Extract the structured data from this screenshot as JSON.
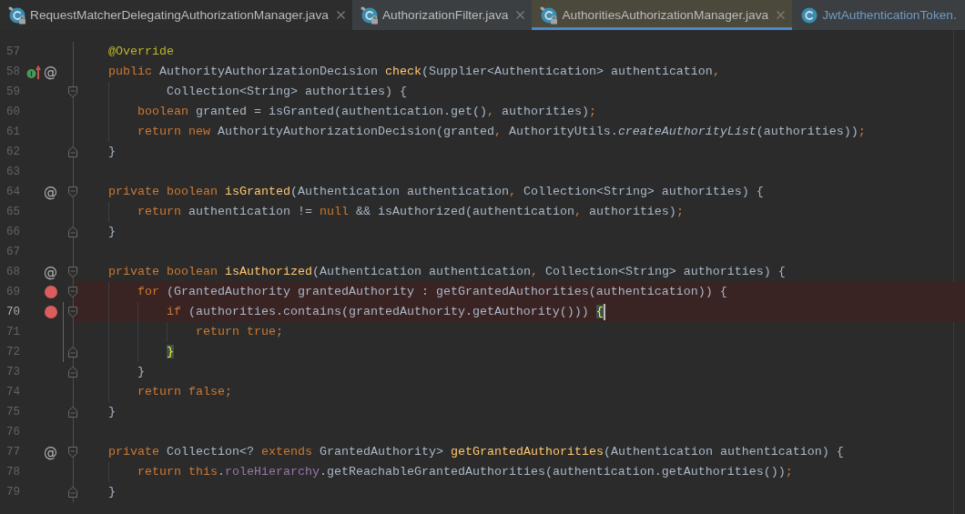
{
  "tabs": [
    {
      "label": "RequestMatcherDelegatingAuthorizationManager.java",
      "selected": false,
      "hovered": true,
      "read_only": true,
      "modified": false,
      "closable": true
    },
    {
      "label": "AuthorizationFilter.java",
      "selected": false,
      "hovered": false,
      "read_only": true,
      "modified": false,
      "closable": true
    },
    {
      "label": "AuthoritiesAuthorizationManager.java",
      "selected": true,
      "hovered": false,
      "read_only": true,
      "modified": false,
      "closable": true
    },
    {
      "label": "JwtAuthenticationToken.",
      "selected": false,
      "hovered": false,
      "read_only": false,
      "modified": true,
      "closable": false
    }
  ],
  "editor": {
    "lines": [
      {
        "number": "57",
        "kind": "code",
        "tokens": [
          {
            "kind": "annotation",
            "text": "@Override"
          }
        ],
        "overrides": false,
        "breakpoint": false,
        "current": false
      },
      {
        "number": "58",
        "kind": "code",
        "tokens": [
          {
            "kind": "keyword",
            "text": "public"
          },
          {
            "kind": "plain",
            "text": " AuthorityAuthorizationDecision "
          },
          {
            "kind": "method",
            "text": "check"
          },
          {
            "kind": "plain",
            "text": "(Supplier<Authentication> authentication"
          },
          {
            "kind": "punct",
            "text": ","
          }
        ],
        "mark": "@",
        "overrides": true,
        "breakpoint": false,
        "current": false,
        "children": [
          {
            "number": "59",
            "kind": "continuation",
            "tokens": [
              {
                "kind": "plain",
                "text": "Collection<String> authorities) {"
              }
            ],
            "overrides": false,
            "breakpoint": false,
            "current": false
          },
          {
            "number": "60",
            "kind": "code",
            "tokens": [
              {
                "kind": "keyword",
                "text": "boolean"
              },
              {
                "kind": "plain",
                "text": " granted = isGranted(authentication.get()"
              },
              {
                "kind": "punct",
                "text": ","
              },
              {
                "kind": "plain",
                "text": " authorities)"
              },
              {
                "kind": "punct",
                "text": ";"
              }
            ],
            "overrides": false,
            "breakpoint": false,
            "current": false
          },
          {
            "number": "61",
            "kind": "code",
            "tokens": [
              {
                "kind": "keyword",
                "text": "return new"
              },
              {
                "kind": "plain",
                "text": " AuthorityAuthorizationDecision(granted"
              },
              {
                "kind": "punct",
                "text": ","
              },
              {
                "kind": "plain",
                "text": " AuthorityUtils."
              },
              {
                "kind": "static",
                "text": "createAuthorityList"
              },
              {
                "kind": "plain",
                "text": "(authorities))"
              },
              {
                "kind": "punct",
                "text": ";"
              }
            ],
            "overrides": false,
            "breakpoint": false,
            "current": false
          }
        ]
      },
      {
        "number": "62",
        "kind": "code",
        "tokens": [
          {
            "kind": "plain",
            "text": "}"
          }
        ],
        "overrides": false,
        "breakpoint": false,
        "current": false
      },
      {
        "number": "63",
        "kind": "blank",
        "overrides": false,
        "breakpoint": false,
        "current": false
      },
      {
        "number": "64",
        "kind": "code",
        "tokens": [
          {
            "kind": "keyword",
            "text": "private boolean "
          },
          {
            "kind": "method",
            "text": "isGranted"
          },
          {
            "kind": "plain",
            "text": "(Authentication authentication"
          },
          {
            "kind": "punct",
            "text": ","
          },
          {
            "kind": "plain",
            "text": " Collection<String> authorities) {"
          }
        ],
        "mark": "@",
        "overrides": false,
        "breakpoint": false,
        "current": false,
        "children": [
          {
            "number": "65",
            "kind": "code",
            "tokens": [
              {
                "kind": "keyword",
                "text": "return"
              },
              {
                "kind": "plain",
                "text": " authentication != "
              },
              {
                "kind": "keyword",
                "text": "null"
              },
              {
                "kind": "plain",
                "text": " && isAuthorized(authentication"
              },
              {
                "kind": "punct",
                "text": ","
              },
              {
                "kind": "plain",
                "text": " authorities)"
              },
              {
                "kind": "punct",
                "text": ";"
              }
            ],
            "overrides": false,
            "breakpoint": false,
            "current": false
          }
        ]
      },
      {
        "number": "66",
        "kind": "code",
        "tokens": [
          {
            "kind": "plain",
            "text": "}"
          }
        ],
        "overrides": false,
        "breakpoint": false,
        "current": false
      },
      {
        "number": "67",
        "kind": "blank",
        "overrides": false,
        "breakpoint": false,
        "current": false
      },
      {
        "number": "68",
        "kind": "code",
        "tokens": [
          {
            "kind": "keyword",
            "text": "private boolean "
          },
          {
            "kind": "method",
            "text": "isAuthorized"
          },
          {
            "kind": "plain",
            "text": "(Authentication authentication"
          },
          {
            "kind": "punct",
            "text": ","
          },
          {
            "kind": "plain",
            "text": " Collection<String> authorities) {"
          }
        ],
        "mark": "@",
        "overrides": false,
        "breakpoint": false,
        "current": false,
        "children": [
          {
            "number": "69",
            "kind": "code",
            "tokens": [
              {
                "kind": "keyword",
                "text": "for"
              },
              {
                "kind": "plain",
                "text": " (GrantedAuthority grantedAuthority : getGrantedAuthorities(authentication)) {"
              }
            ],
            "overrides": false,
            "breakpoint": true,
            "current": false,
            "children": [
              {
                "number": "70",
                "kind": "code",
                "tokens": [
                  {
                    "kind": "keyword",
                    "text": "if"
                  },
                  {
                    "kind": "plain",
                    "text": " (authorities.contains(grantedAuthority.getAuthority())) "
                  },
                  {
                    "kind": "brace_match",
                    "text": "{"
                  }
                ],
                "overrides": false,
                "breakpoint": true,
                "current": true,
                "children": [
                  {
                    "number": "71",
                    "kind": "code",
                    "tokens": [
                      {
                        "kind": "keyword",
                        "text": "return true"
                      },
                      {
                        "kind": "punct",
                        "text": ";"
                      }
                    ],
                    "overrides": false,
                    "breakpoint": false,
                    "current": false
                  }
                ]
              },
              {
                "number": "72",
                "kind": "code",
                "tokens": [
                  {
                    "kind": "brace_match",
                    "text": "}"
                  }
                ],
                "overrides": false,
                "breakpoint": false,
                "current": false
              }
            ]
          },
          {
            "number": "73",
            "kind": "code",
            "tokens": [
              {
                "kind": "plain",
                "text": "}"
              }
            ],
            "overrides": false,
            "breakpoint": false,
            "current": false
          },
          {
            "number": "74",
            "kind": "code",
            "tokens": [
              {
                "kind": "keyword",
                "text": "return false"
              },
              {
                "kind": "punct",
                "text": ";"
              }
            ],
            "overrides": false,
            "breakpoint": false,
            "current": false
          }
        ]
      },
      {
        "number": "75",
        "kind": "code",
        "tokens": [
          {
            "kind": "plain",
            "text": "}"
          }
        ],
        "overrides": false,
        "breakpoint": false,
        "current": false
      },
      {
        "number": "76",
        "kind": "blank",
        "overrides": false,
        "breakpoint": false,
        "current": false
      },
      {
        "number": "77",
        "kind": "code",
        "tokens": [
          {
            "kind": "keyword",
            "text": "private"
          },
          {
            "kind": "plain",
            "text": " Collection<? "
          },
          {
            "kind": "keyword",
            "text": "extends"
          },
          {
            "kind": "plain",
            "text": " GrantedAuthority> "
          },
          {
            "kind": "method",
            "text": "getGrantedAuthorities"
          },
          {
            "kind": "plain",
            "text": "(Authentication authentication) {"
          }
        ],
        "mark": "@",
        "overrides": false,
        "breakpoint": false,
        "current": false,
        "children": [
          {
            "number": "78",
            "kind": "code",
            "tokens": [
              {
                "kind": "keyword",
                "text": "return this"
              },
              {
                "kind": "plain",
                "text": "."
              },
              {
                "kind": "field",
                "text": "roleHierarchy"
              },
              {
                "kind": "plain",
                "text": ".getReachableGrantedAuthorities(authentication.getAuthorities())"
              },
              {
                "kind": "punct",
                "text": ";"
              }
            ],
            "overrides": false,
            "breakpoint": false,
            "current": false
          }
        ]
      },
      {
        "number": "79",
        "kind": "code",
        "tokens": [
          {
            "kind": "plain",
            "text": "}"
          }
        ],
        "overrides": false,
        "breakpoint": false,
        "current": false
      }
    ]
  }
}
